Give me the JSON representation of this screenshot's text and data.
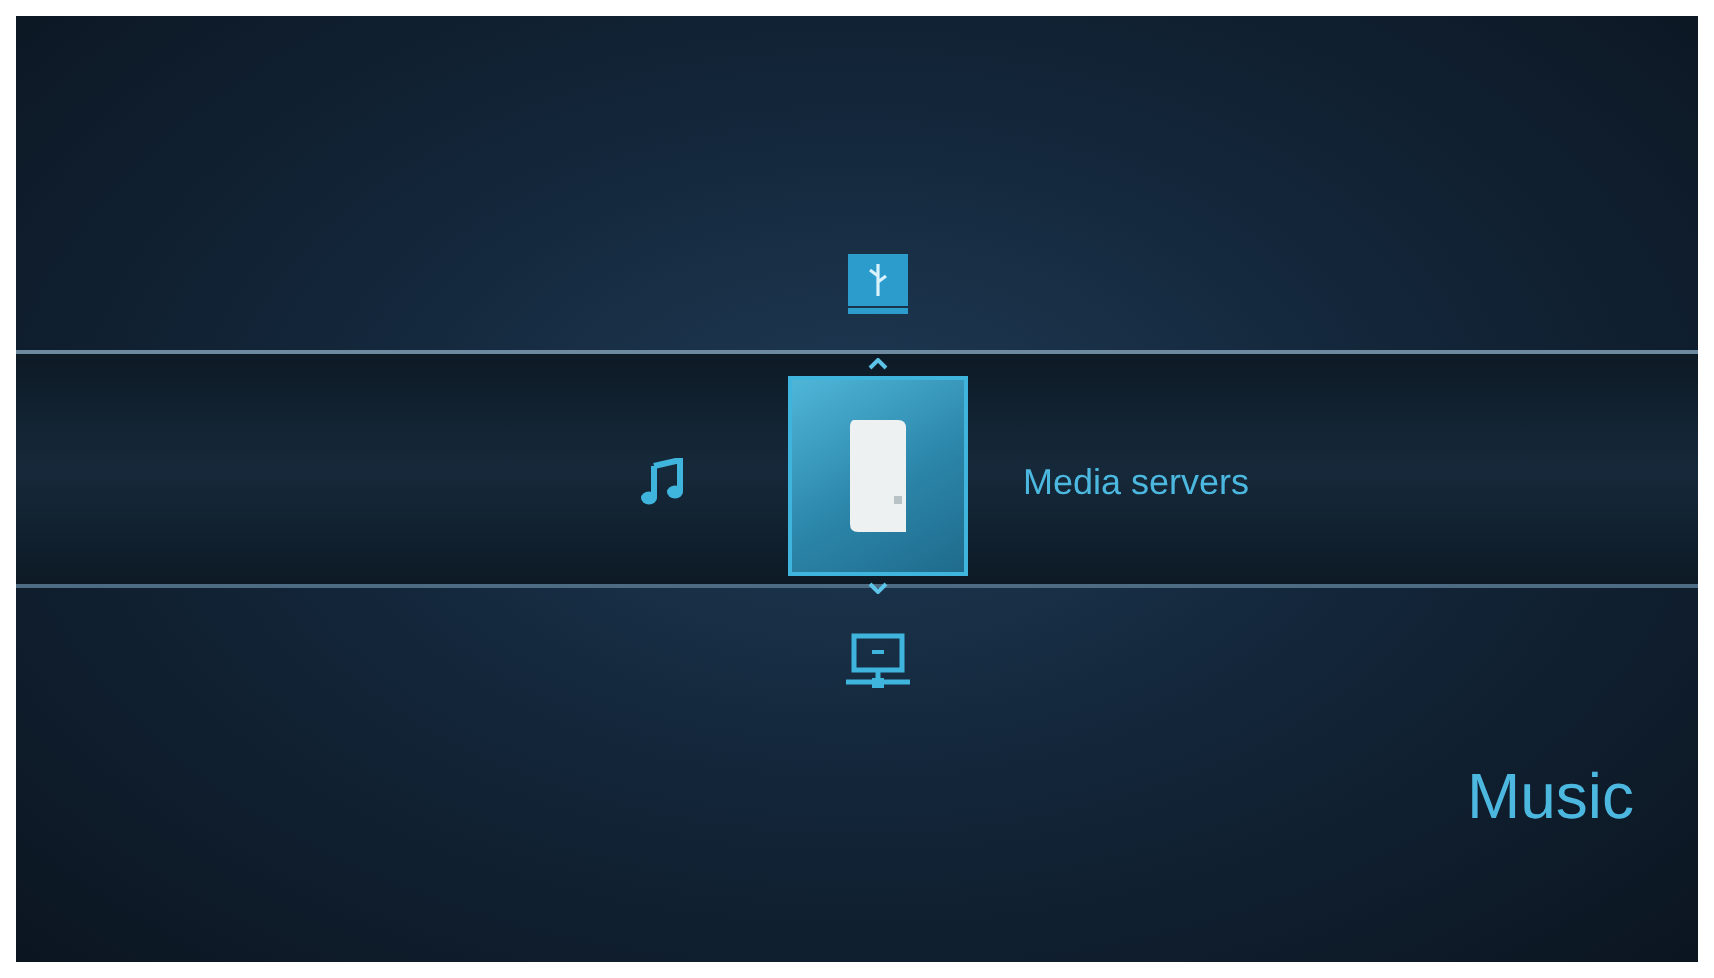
{
  "selected_source": {
    "label": "Media servers"
  },
  "section_title": "Music"
}
